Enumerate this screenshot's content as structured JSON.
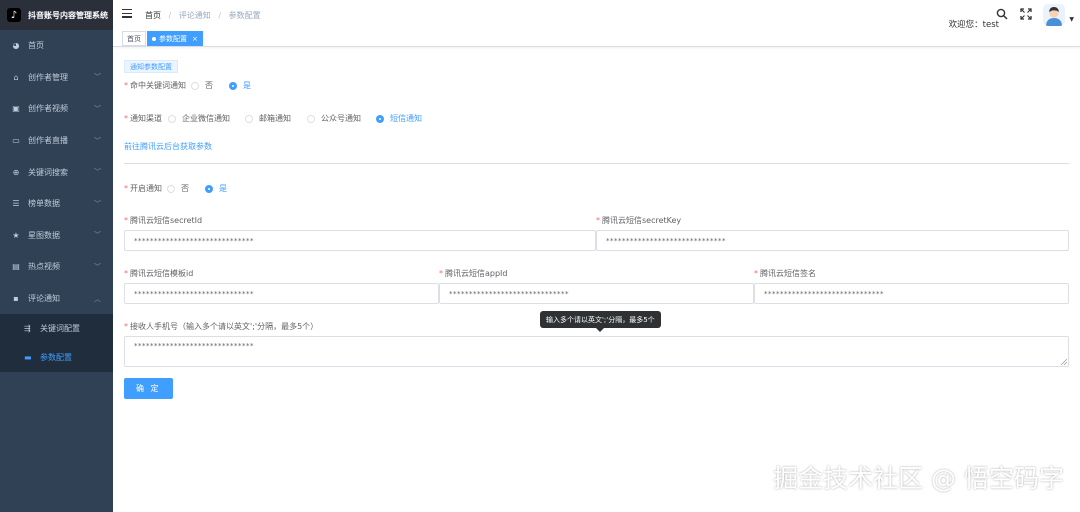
{
  "app": {
    "title": "抖音账号内容管理系统",
    "logo_glyph": "♪"
  },
  "sidebar": {
    "items": [
      {
        "label": "首页",
        "icon": "dashboard-icon",
        "glyph": "◕",
        "has_children": false
      },
      {
        "label": "创作者管理",
        "icon": "creator-icon",
        "glyph": "⌂",
        "has_children": true
      },
      {
        "label": "创作者视频",
        "icon": "video-icon",
        "glyph": "▣",
        "has_children": true
      },
      {
        "label": "创作者直播",
        "icon": "live-icon",
        "glyph": "▭",
        "has_children": true
      },
      {
        "label": "关键词搜索",
        "icon": "search-icon",
        "glyph": "⊕",
        "has_children": true
      },
      {
        "label": "榜单数据",
        "icon": "list-icon",
        "glyph": "☰",
        "has_children": true
      },
      {
        "label": "星图数据",
        "icon": "star-icon",
        "glyph": "★",
        "has_children": true
      },
      {
        "label": "热点视频",
        "icon": "hot-video-icon",
        "glyph": "▤",
        "has_children": true
      },
      {
        "label": "评论通知",
        "icon": "comment-icon",
        "glyph": "▪",
        "has_children": true,
        "expanded": true
      }
    ],
    "subitems": [
      {
        "label": "关键词配置",
        "icon": "keyword-config-icon",
        "glyph": "⇶",
        "active": false
      },
      {
        "label": "参数配置",
        "icon": "param-config-icon",
        "glyph": "▬",
        "active": true
      }
    ]
  },
  "navbar": {
    "breadcrumb": [
      "首页",
      "评论通知",
      "参数配置"
    ],
    "welcome": "欢迎您：test"
  },
  "tags": [
    {
      "label": "首页",
      "active": false
    },
    {
      "label": "参数配置",
      "active": true,
      "close": "×"
    }
  ],
  "form": {
    "section_tag": "通知参数配置",
    "keyword_notify": {
      "label": "命中关键词通知",
      "options": [
        "否",
        "是"
      ],
      "selected": "是"
    },
    "channel": {
      "label": "通知渠道",
      "options": [
        "企业微信通知",
        "邮箱通知",
        "公众号通知",
        "短信通知"
      ],
      "selected": "短信通知"
    },
    "tencent_link": "前往腾讯云后台获取参数",
    "enable_notify": {
      "label": "开启通知",
      "options": [
        "否",
        "是"
      ],
      "selected": "是"
    },
    "secret_id": {
      "label": "腾讯云短信secretId",
      "value": "******************************"
    },
    "secret_key": {
      "label": "腾讯云短信secretKey",
      "value": "******************************"
    },
    "template_id": {
      "label": "腾讯云短信模板id",
      "value": "******************************"
    },
    "app_id": {
      "label": "腾讯云短信appId",
      "value": "******************************"
    },
    "sign_name": {
      "label": "腾讯云短信签名",
      "value": "******************************"
    },
    "phones": {
      "label": "接收人手机号（输入多个请以英文';'分隔，最多5个）",
      "value": "******************************",
      "tooltip": "输入多个请以英文';'分隔，最多5个"
    },
    "submit_label": "确 定"
  },
  "watermark": "掘金技术社区 @ 悟空码字",
  "colors": {
    "sidebar_bg": "#304156",
    "primary": "#409eff",
    "required": "#f56c6c"
  }
}
